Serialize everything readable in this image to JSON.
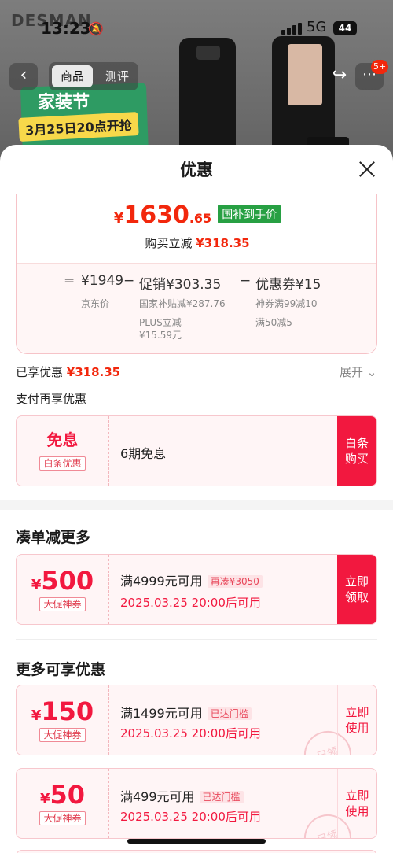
{
  "background": {
    "brand": "DESMAN",
    "time": "13:23",
    "network": "5G",
    "battery": "44",
    "tabs": [
      "商品",
      "测评"
    ],
    "cart_badge": "5+",
    "promo_title": "家装节",
    "promo_date": "3月25日20点开抢"
  },
  "sheet": {
    "title": "优惠",
    "final_price": {
      "currency": "¥",
      "integer": "1630",
      "decimal": ".65",
      "tag": "国补到手价"
    },
    "discount_line": {
      "label": "购买立减",
      "value": "¥318.35"
    },
    "breakdown": {
      "eq": "=",
      "base_price": "¥1949",
      "base_label": "京东价",
      "minus1": "−",
      "promo_label": "促销¥303.35",
      "promo_detail1": "国家补贴减¥287.76",
      "promo_detail2": "PLUS立减",
      "promo_detail3": "¥15.59元",
      "minus2": "−",
      "coupon_label": "优惠券¥15",
      "coupon_detail1": "神券满99减10",
      "coupon_detail2": "满50减5"
    },
    "saved": {
      "label": "已享优惠",
      "value": "¥318.35",
      "expand": "展开"
    },
    "pay_title": "支付再享优惠",
    "pay_card": {
      "title": "免息",
      "tag": "白条优惠",
      "desc": "6期免息",
      "button": "白条购买"
    },
    "section1_title": "凑单减更多",
    "coupon1": {
      "currency": "¥",
      "amount": "500",
      "tag": "大促神券",
      "condition": "满4999元可用",
      "status": "再凑¥3050",
      "time": "2025.03.25 20:00后可用",
      "button": "立即领取"
    },
    "section2_title": "更多可享优惠",
    "coupon2": {
      "currency": "¥",
      "amount": "150",
      "tag": "大促神券",
      "condition": "满1499元可用",
      "status": "已达门槛",
      "time": "2025.03.25 20:00后可用",
      "button": "立即使用",
      "stamp": "已领"
    },
    "coupon3": {
      "currency": "¥",
      "amount": "50",
      "tag": "大促神券",
      "condition": "满499元可用",
      "status": "已达门槛",
      "time": "2025.03.25 20:00后可用",
      "button": "立即使用",
      "stamp": "已领"
    }
  },
  "colors": {
    "accent": "#f2183f",
    "price_red": "#f2270c",
    "green_tag": "#27a043"
  }
}
